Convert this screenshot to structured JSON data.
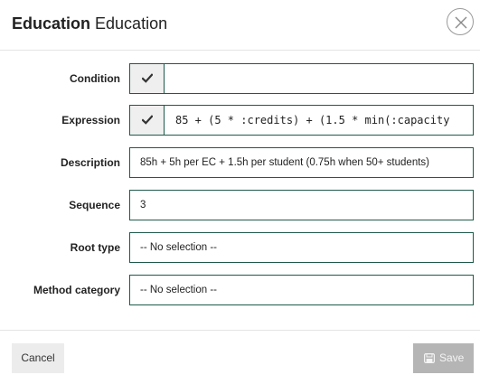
{
  "dialog": {
    "title_bold": "Education",
    "title_rest": "Education"
  },
  "form": {
    "condition": {
      "label": "Condition",
      "checked": true,
      "value": ""
    },
    "expression": {
      "label": "Expression",
      "checked": true,
      "value": "85 + (5 * :credits) + (1.5 * min(:capacity"
    },
    "description": {
      "label": "Description",
      "value": "85h + 5h per EC + 1.5h per student (0.75h when 50+ students)"
    },
    "sequence": {
      "label": "Sequence",
      "value": "3"
    },
    "root_type": {
      "label": "Root type",
      "selected": "-- No selection --"
    },
    "method_category": {
      "label": "Method category",
      "selected": "-- No selection --"
    }
  },
  "footer": {
    "cancel_label": "Cancel",
    "save_label": "Save"
  }
}
